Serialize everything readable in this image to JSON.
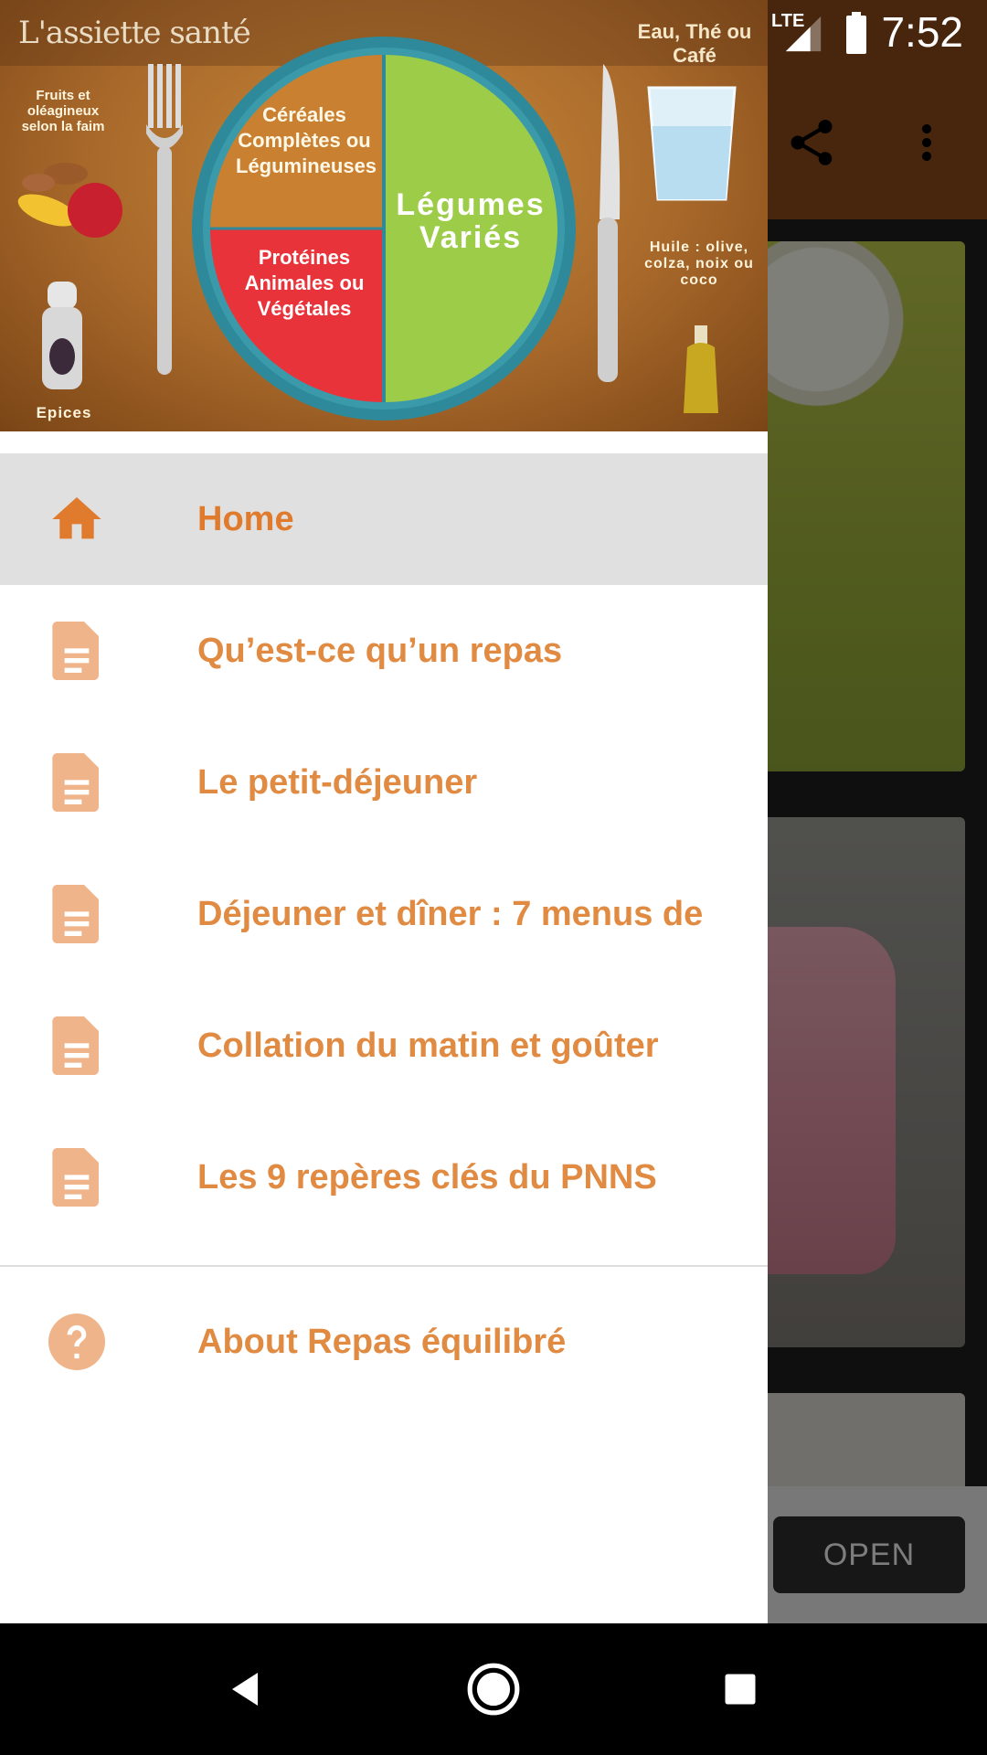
{
  "status_bar": {
    "network": "LTE",
    "time": "7:52"
  },
  "app_toolbar": {
    "icons": [
      "share-icon",
      "more-vert-icon"
    ]
  },
  "ad": {
    "open_label": "OPEN"
  },
  "drawer": {
    "header": {
      "title": "L'assiette santé",
      "drink_label": "Eau, Thé ou Café",
      "fruit_label": "Fruits et oléagineux selon la faim",
      "oil_label": "Huile : olive, colza, noix ou coco",
      "spice_label": "Epices",
      "plate": {
        "cereal_label": "Céréales Complètes ou Légumineuses",
        "vegetables_label": "Légumes Variés",
        "protein_label": "Protéines Animales ou Végétales"
      }
    },
    "items": [
      {
        "label": "Home",
        "icon": "home-icon",
        "active": true
      },
      {
        "label": "Qu’est-ce qu’un repas",
        "icon": "document-icon",
        "active": false
      },
      {
        "label": "Le petit-déjeuner",
        "icon": "document-icon",
        "active": false
      },
      {
        "label": "Déjeuner et dîner : 7 menus de",
        "icon": "document-icon",
        "active": false
      },
      {
        "label": "Collation du matin et goûter",
        "icon": "document-icon",
        "active": false
      },
      {
        "label": "Les 9 repères clés du PNNS",
        "icon": "document-icon",
        "active": false
      }
    ],
    "footer_items": [
      {
        "label": "About Repas équilibré",
        "icon": "help-icon"
      }
    ]
  },
  "colors": {
    "accent": "#e08a42",
    "active_background": "#e0e0e0",
    "toolbar": "#8a4a1a"
  },
  "nav_bar": {
    "buttons": [
      "back-icon",
      "home-circle-icon",
      "recents-icon"
    ]
  }
}
